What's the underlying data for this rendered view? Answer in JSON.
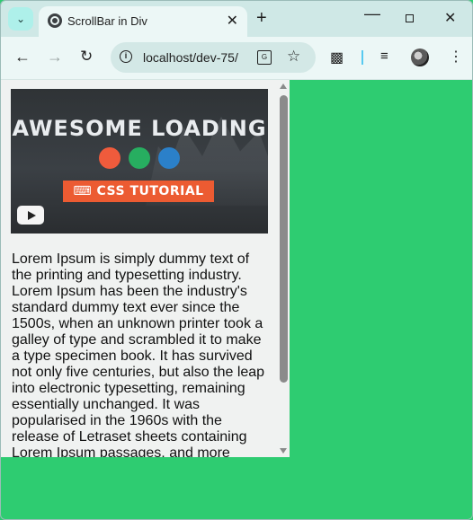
{
  "browser": {
    "tab_title": "ScrollBar in Div",
    "url": "localhost/dev-75/",
    "icons": {
      "tab_search": "chevron-down-icon",
      "favicon": "globe-icon",
      "close": "close-icon",
      "new_tab": "plus-icon",
      "minimize": "minimize-icon",
      "maximize": "maximize-icon",
      "window_close": "close-icon",
      "back": "arrow-left-icon",
      "forward": "arrow-right-icon",
      "reload": "reload-icon",
      "site_info": "info-icon",
      "translate": "translate-icon",
      "bookmark": "star-icon",
      "extensions": "puzzle-icon",
      "media": "media-queue-icon",
      "profile": "avatar",
      "menu": "kebab-menu-icon"
    }
  },
  "page": {
    "background_color": "#2ecc71",
    "thumbnail": {
      "title": "AWESOME LOADING",
      "badge": "CSS TUTORIAL",
      "dot_colors": [
        "#ef5b3c",
        "#27ae60",
        "#2b80c9"
      ]
    },
    "paragraph": "Lorem Ipsum is simply dummy text of the printing and typesetting industry. Lorem Ipsum has been the industry's standard dummy text ever since the 1500s, when an unknown printer took a galley of type and scrambled it to make a type specimen book. It has survived not only five centuries, but also the leap into electronic typesetting, remaining essentially unchanged. It was popularised in the 1960s with the release of Letraset sheets containing Lorem Ipsum passages, and more"
  }
}
